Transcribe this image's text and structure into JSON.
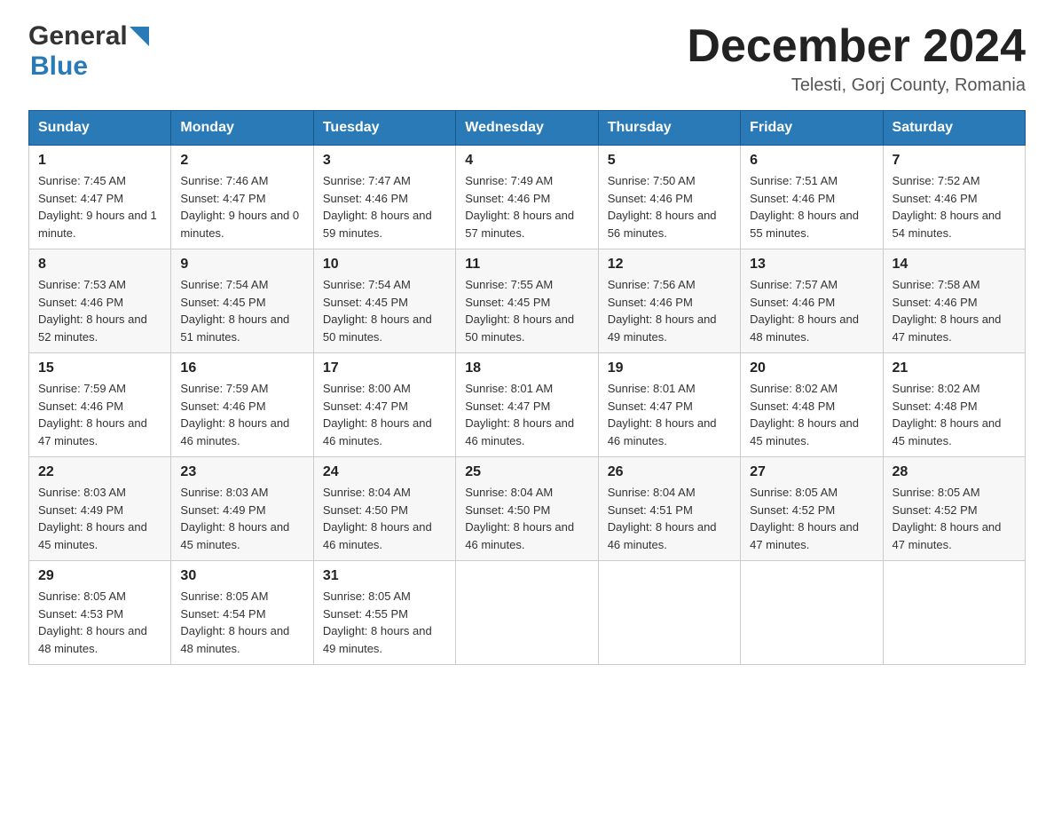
{
  "logo": {
    "general": "General",
    "blue": "Blue"
  },
  "title": {
    "month_year": "December 2024",
    "location": "Telesti, Gorj County, Romania"
  },
  "headers": [
    "Sunday",
    "Monday",
    "Tuesday",
    "Wednesday",
    "Thursday",
    "Friday",
    "Saturday"
  ],
  "weeks": [
    [
      {
        "day": "1",
        "sunrise": "7:45 AM",
        "sunset": "4:47 PM",
        "daylight": "9 hours and 1 minute."
      },
      {
        "day": "2",
        "sunrise": "7:46 AM",
        "sunset": "4:47 PM",
        "daylight": "9 hours and 0 minutes."
      },
      {
        "day": "3",
        "sunrise": "7:47 AM",
        "sunset": "4:46 PM",
        "daylight": "8 hours and 59 minutes."
      },
      {
        "day": "4",
        "sunrise": "7:49 AM",
        "sunset": "4:46 PM",
        "daylight": "8 hours and 57 minutes."
      },
      {
        "day": "5",
        "sunrise": "7:50 AM",
        "sunset": "4:46 PM",
        "daylight": "8 hours and 56 minutes."
      },
      {
        "day": "6",
        "sunrise": "7:51 AM",
        "sunset": "4:46 PM",
        "daylight": "8 hours and 55 minutes."
      },
      {
        "day": "7",
        "sunrise": "7:52 AM",
        "sunset": "4:46 PM",
        "daylight": "8 hours and 54 minutes."
      }
    ],
    [
      {
        "day": "8",
        "sunrise": "7:53 AM",
        "sunset": "4:46 PM",
        "daylight": "8 hours and 52 minutes."
      },
      {
        "day": "9",
        "sunrise": "7:54 AM",
        "sunset": "4:45 PM",
        "daylight": "8 hours and 51 minutes."
      },
      {
        "day": "10",
        "sunrise": "7:54 AM",
        "sunset": "4:45 PM",
        "daylight": "8 hours and 50 minutes."
      },
      {
        "day": "11",
        "sunrise": "7:55 AM",
        "sunset": "4:45 PM",
        "daylight": "8 hours and 50 minutes."
      },
      {
        "day": "12",
        "sunrise": "7:56 AM",
        "sunset": "4:46 PM",
        "daylight": "8 hours and 49 minutes."
      },
      {
        "day": "13",
        "sunrise": "7:57 AM",
        "sunset": "4:46 PM",
        "daylight": "8 hours and 48 minutes."
      },
      {
        "day": "14",
        "sunrise": "7:58 AM",
        "sunset": "4:46 PM",
        "daylight": "8 hours and 47 minutes."
      }
    ],
    [
      {
        "day": "15",
        "sunrise": "7:59 AM",
        "sunset": "4:46 PM",
        "daylight": "8 hours and 47 minutes."
      },
      {
        "day": "16",
        "sunrise": "7:59 AM",
        "sunset": "4:46 PM",
        "daylight": "8 hours and 46 minutes."
      },
      {
        "day": "17",
        "sunrise": "8:00 AM",
        "sunset": "4:47 PM",
        "daylight": "8 hours and 46 minutes."
      },
      {
        "day": "18",
        "sunrise": "8:01 AM",
        "sunset": "4:47 PM",
        "daylight": "8 hours and 46 minutes."
      },
      {
        "day": "19",
        "sunrise": "8:01 AM",
        "sunset": "4:47 PM",
        "daylight": "8 hours and 46 minutes."
      },
      {
        "day": "20",
        "sunrise": "8:02 AM",
        "sunset": "4:48 PM",
        "daylight": "8 hours and 45 minutes."
      },
      {
        "day": "21",
        "sunrise": "8:02 AM",
        "sunset": "4:48 PM",
        "daylight": "8 hours and 45 minutes."
      }
    ],
    [
      {
        "day": "22",
        "sunrise": "8:03 AM",
        "sunset": "4:49 PM",
        "daylight": "8 hours and 45 minutes."
      },
      {
        "day": "23",
        "sunrise": "8:03 AM",
        "sunset": "4:49 PM",
        "daylight": "8 hours and 45 minutes."
      },
      {
        "day": "24",
        "sunrise": "8:04 AM",
        "sunset": "4:50 PM",
        "daylight": "8 hours and 46 minutes."
      },
      {
        "day": "25",
        "sunrise": "8:04 AM",
        "sunset": "4:50 PM",
        "daylight": "8 hours and 46 minutes."
      },
      {
        "day": "26",
        "sunrise": "8:04 AM",
        "sunset": "4:51 PM",
        "daylight": "8 hours and 46 minutes."
      },
      {
        "day": "27",
        "sunrise": "8:05 AM",
        "sunset": "4:52 PM",
        "daylight": "8 hours and 47 minutes."
      },
      {
        "day": "28",
        "sunrise": "8:05 AM",
        "sunset": "4:52 PM",
        "daylight": "8 hours and 47 minutes."
      }
    ],
    [
      {
        "day": "29",
        "sunrise": "8:05 AM",
        "sunset": "4:53 PM",
        "daylight": "8 hours and 48 minutes."
      },
      {
        "day": "30",
        "sunrise": "8:05 AM",
        "sunset": "4:54 PM",
        "daylight": "8 hours and 48 minutes."
      },
      {
        "day": "31",
        "sunrise": "8:05 AM",
        "sunset": "4:55 PM",
        "daylight": "8 hours and 49 minutes."
      },
      null,
      null,
      null,
      null
    ]
  ]
}
